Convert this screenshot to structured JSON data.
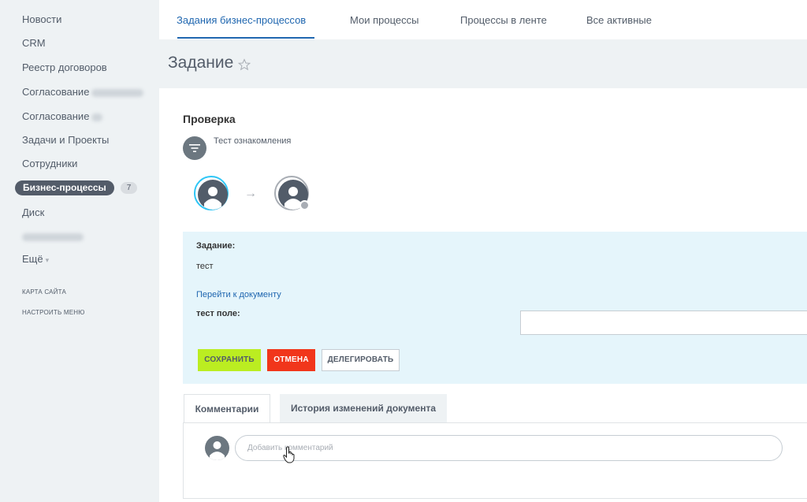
{
  "sidebar": {
    "items": [
      {
        "label": "Новости"
      },
      {
        "label": "CRM"
      },
      {
        "label": "Реестр договоров"
      },
      {
        "label": "Согласование"
      },
      {
        "label": "Согласование"
      },
      {
        "label": "Задачи и Проекты"
      },
      {
        "label": "Сотрудники"
      },
      {
        "label": "Бизнес-процессы",
        "count": "7"
      },
      {
        "label": "Диск"
      },
      {
        "label": ""
      },
      {
        "label": "Ещё"
      }
    ],
    "sitemap": "КАРТА САЙТА",
    "configure_menu": "НАСТРОИТЬ МЕНЮ"
  },
  "top_tabs": [
    {
      "label": "Задания бизнес-процессов"
    },
    {
      "label": "Мои процессы"
    },
    {
      "label": "Процессы в ленте"
    },
    {
      "label": "Все активные"
    }
  ],
  "page": {
    "title": "Задание",
    "bp_title": "Проверка",
    "bp_desc": "Тест ознакомления"
  },
  "task": {
    "task_label": "Задание:",
    "task_value": "тест",
    "doc_link": "Перейти к документу",
    "field_label": "тест поле:",
    "field_value": "",
    "save": "СОХРАНИТЬ",
    "cancel": "ОТМЕНА",
    "delegate": "ДЕЛЕГИРОВАТЬ"
  },
  "comments": {
    "tab_comments": "Комментарии",
    "tab_history": "История изменений документа",
    "placeholder": "Добавить комментарий"
  },
  "colors": {
    "accent": "#2067b0",
    "save": "#bbed21",
    "cancel": "#f1361b",
    "panel": "#e5f5fb",
    "active_avatar_ring": "#2fc6f6"
  }
}
